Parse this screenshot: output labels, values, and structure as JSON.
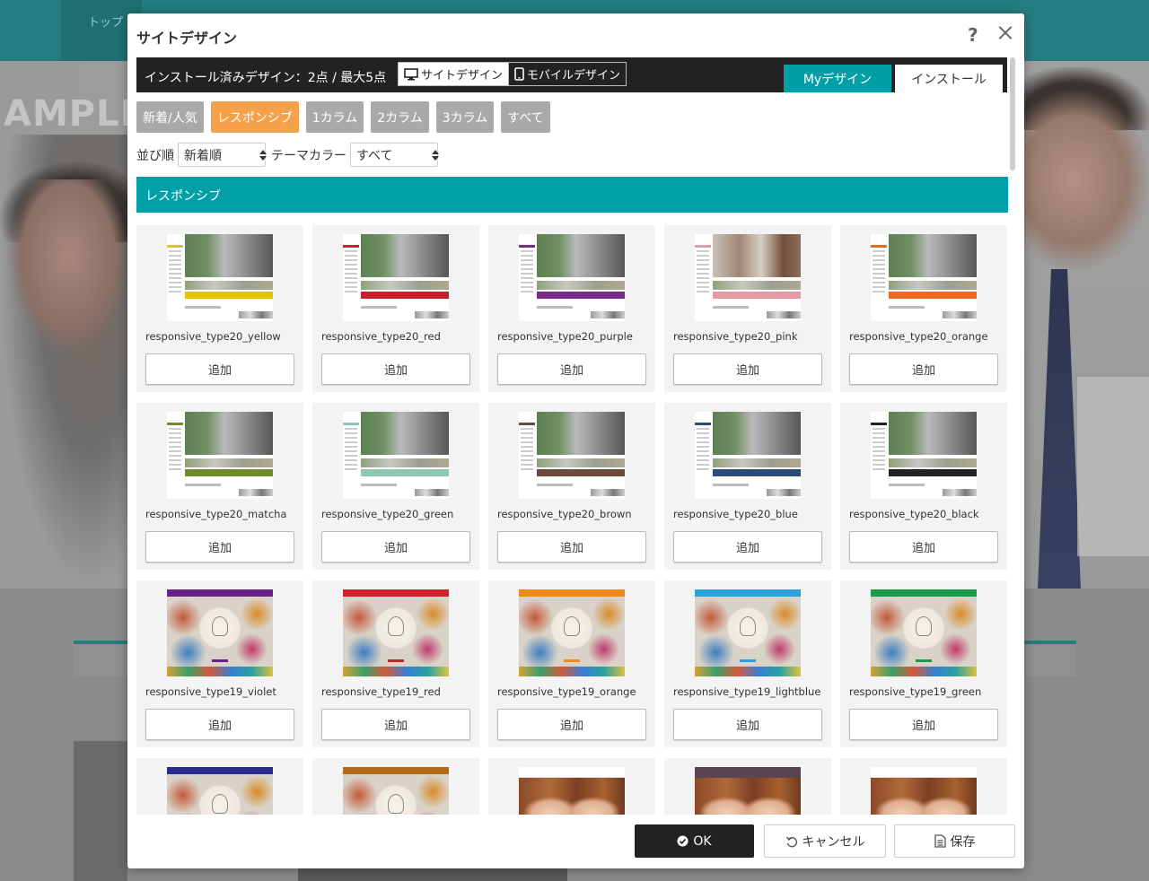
{
  "background": {
    "nav_label": "トップ",
    "hero_text": "AMPLE"
  },
  "modal": {
    "title": "サイトデザイン",
    "help_label": "?",
    "installed_text": "インストール済みデザイン：2点 / 最大5点",
    "segment": {
      "site_label": "サイトデザイン",
      "mobile_label": "モバイルデザイン"
    },
    "tabs": {
      "my_design": "Myデザイン",
      "install": "インストール"
    },
    "categories": [
      "新着/人気",
      "レスポンシブ",
      "1カラム",
      "2カラム",
      "3カラム",
      "すべて"
    ],
    "active_category_index": 1,
    "filters": {
      "sort_label": "並び順",
      "sort_value": "新着順",
      "color_label": "テーマカラー",
      "color_value": "すべて"
    },
    "section_title": "レスポンシブ",
    "add_label": "追加",
    "designs": [
      {
        "name": "responsive_type20_yellow",
        "kind": "t20",
        "accent": "#e2c21a"
      },
      {
        "name": "responsive_type20_red",
        "kind": "t20",
        "accent": "#c8202a"
      },
      {
        "name": "responsive_type20_purple",
        "kind": "t20",
        "accent": "#7a2a8a"
      },
      {
        "name": "responsive_type20_pink",
        "kind": "t20",
        "accent": "#e59aa6"
      },
      {
        "name": "responsive_type20_orange",
        "kind": "t20",
        "accent": "#ee6a22"
      },
      {
        "name": "responsive_type20_matcha",
        "kind": "t20",
        "accent": "#6f8a2a"
      },
      {
        "name": "responsive_type20_green",
        "kind": "t20",
        "accent": "#8cc8b0"
      },
      {
        "name": "responsive_type20_brown",
        "kind": "t20",
        "accent": "#6a4a3a"
      },
      {
        "name": "responsive_type20_blue",
        "kind": "t20",
        "accent": "#2a4a7a"
      },
      {
        "name": "responsive_type20_black",
        "kind": "t20",
        "accent": "#222222"
      },
      {
        "name": "responsive_type19_violet",
        "kind": "t19",
        "accent": "#6a1f8a"
      },
      {
        "name": "responsive_type19_red",
        "kind": "t19",
        "accent": "#d0202a"
      },
      {
        "name": "responsive_type19_orange",
        "kind": "t19",
        "accent": "#f08a1a"
      },
      {
        "name": "responsive_type19_lightblue",
        "kind": "t19",
        "accent": "#2aa0e0"
      },
      {
        "name": "responsive_type19_green",
        "kind": "t19",
        "accent": "#1a9a4a"
      },
      {
        "name": "",
        "kind": "t19",
        "accent": "#2a2a8a"
      },
      {
        "name": "",
        "kind": "t19",
        "accent": "#b06a1a"
      },
      {
        "name": "",
        "kind": "hair",
        "accent": "#ffffff"
      },
      {
        "name": "",
        "kind": "hair-dark",
        "accent": "#5a4450"
      },
      {
        "name": "",
        "kind": "hair",
        "accent": "#ffffff"
      }
    ],
    "footer": {
      "ok_label": "OK",
      "cancel_label": "キャンセル",
      "save_label": "保存"
    }
  }
}
